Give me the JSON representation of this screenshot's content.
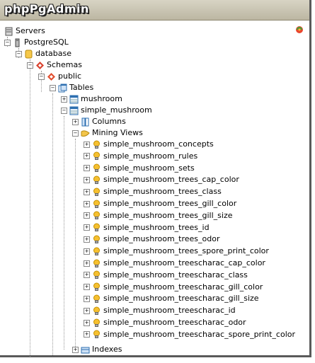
{
  "app": {
    "logo_text": "phpPgAdmin"
  },
  "tree": {
    "servers": "Servers",
    "server": "PostgreSQL",
    "database": "database",
    "schemas": "Schemas",
    "schema": "public",
    "tables": "Tables",
    "table1": "mushroom",
    "table2": "simple_mushroom",
    "columns": "Columns",
    "mining_views": "Mining Views",
    "views": [
      "simple_mushroom_concepts",
      "simple_mushroom_rules",
      "simple_mushroom_sets",
      "simple_mushroom_trees_cap_color",
      "simple_mushroom_trees_class",
      "simple_mushroom_trees_gill_color",
      "simple_mushroom_trees_gill_size",
      "simple_mushroom_trees_id",
      "simple_mushroom_trees_odor",
      "simple_mushroom_trees_spore_print_color",
      "simple_mushroom_treescharac_cap_color",
      "simple_mushroom_treescharac_class",
      "simple_mushroom_treescharac_gill_color",
      "simple_mushroom_treescharac_gill_size",
      "simple_mushroom_treescharac_id",
      "simple_mushroom_treescharac_odor",
      "simple_mushroom_treescharac_spore_print_color"
    ],
    "indexes": "Indexes"
  },
  "colors": {
    "logo_bar": "#c8c2ae",
    "tree_lines": "#999999"
  }
}
